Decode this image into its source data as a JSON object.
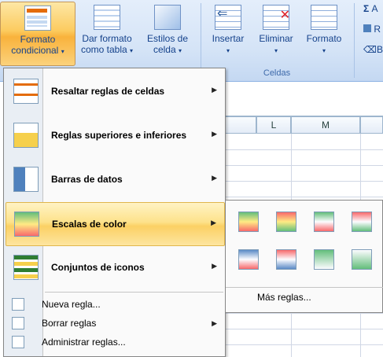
{
  "ribbon": {
    "conditional_format": {
      "line1": "Formato",
      "line2": "condicional"
    },
    "format_as_table": {
      "line1": "Dar formato",
      "line2": "como tabla"
    },
    "cell_styles": {
      "line1": "Estilos de",
      "line2": "celda"
    },
    "insert": {
      "label": "Insertar"
    },
    "delete": {
      "label": "Eliminar"
    },
    "format": {
      "label": "Formato"
    },
    "group_cells": "Celdas",
    "sum_symbol": "Σ",
    "small1": "A",
    "small2": "R",
    "small3": "B"
  },
  "sheet": {
    "columns": [
      "L",
      "M"
    ]
  },
  "menu": {
    "items": [
      {
        "label": "Resaltar reglas de celdas",
        "icon": "highlight-rules-icon"
      },
      {
        "label": "Reglas superiores e inferiores",
        "icon": "top-bottom-rules-icon"
      },
      {
        "label": "Barras de datos",
        "icon": "data-bars-icon"
      },
      {
        "label": "Escalas de color",
        "icon": "color-scales-icon"
      },
      {
        "label": "Conjuntos de iconos",
        "icon": "icon-sets-icon"
      }
    ],
    "small_items": [
      {
        "label": "Nueva regla...",
        "icon": "new-rule-icon"
      },
      {
        "label": "Borrar reglas",
        "icon": "clear-rules-icon"
      },
      {
        "label": "Administrar reglas...",
        "icon": "manage-rules-icon"
      }
    ]
  },
  "submenu": {
    "more_rules": "Más reglas...",
    "scales": [
      [
        "#63be7b",
        "#ffeb84",
        "#f8696b"
      ],
      [
        "#f8696b",
        "#ffeb84",
        "#63be7b"
      ],
      [
        "#63be7b",
        "#fcfcff",
        "#f8696b"
      ],
      [
        "#f8696b",
        "#fcfcff",
        "#63be7b"
      ],
      [
        "#5a8ac6",
        "#fcfcff",
        "#f8696b"
      ],
      [
        "#f8696b",
        "#fcfcff",
        "#5a8ac6"
      ],
      [
        "#63be7b",
        "#fcfcff"
      ],
      [
        "#fcfcff",
        "#63be7b"
      ]
    ]
  }
}
